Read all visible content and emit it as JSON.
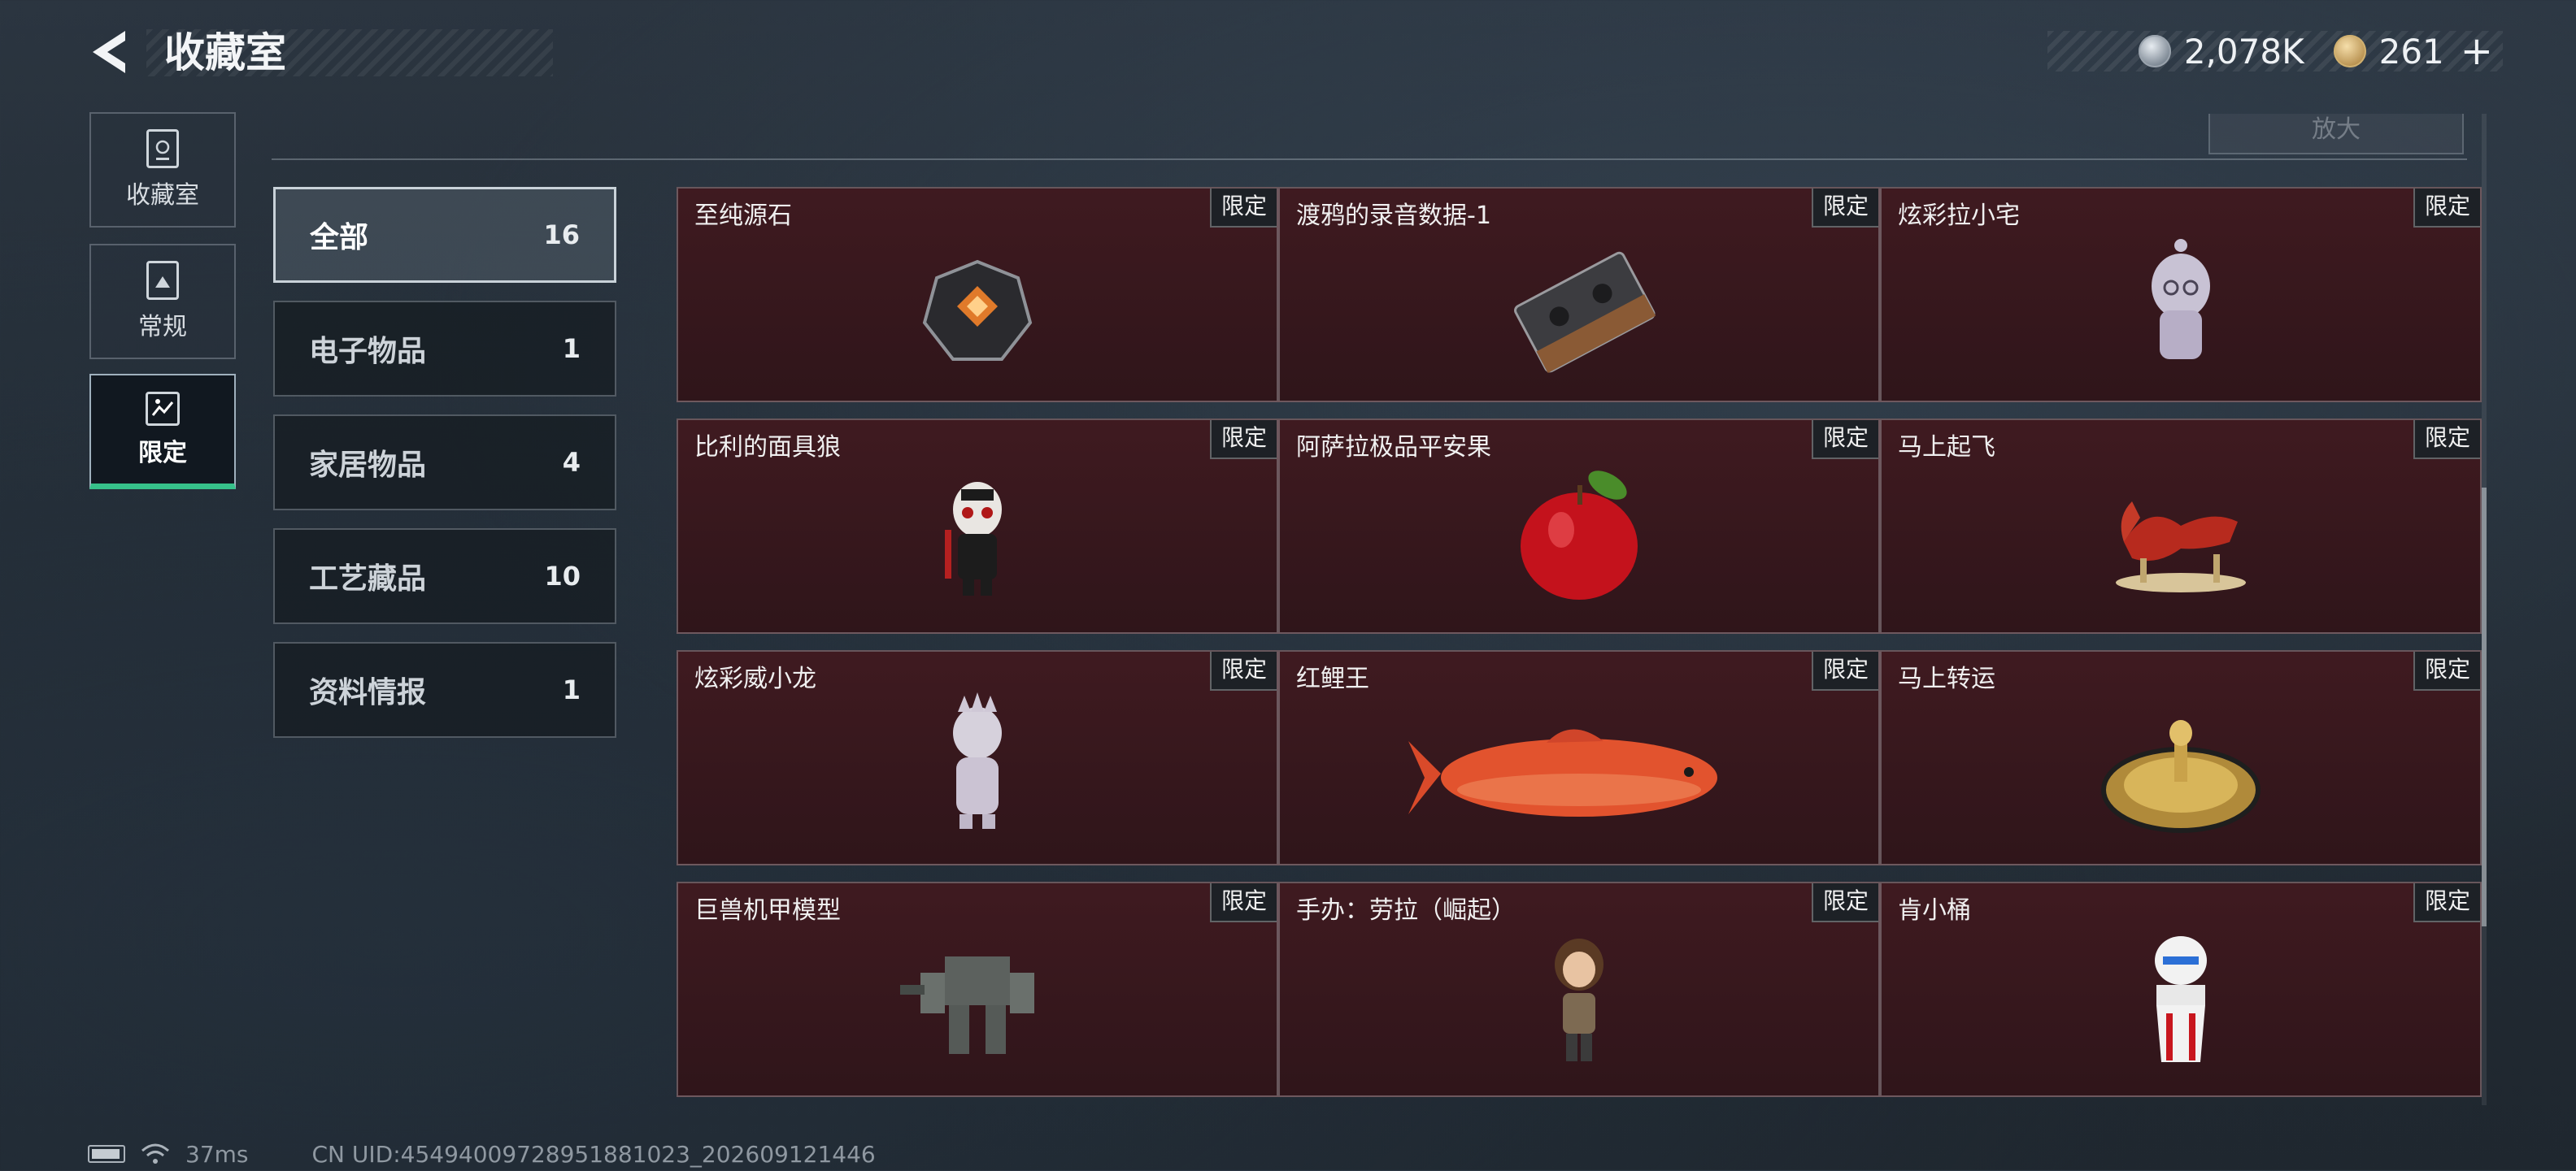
{
  "header": {
    "title": "收藏室",
    "currency": [
      {
        "icon": "silver-coin-icon",
        "value": "2,078K"
      },
      {
        "icon": "gold-coin-icon",
        "value": "261"
      }
    ],
    "plus": "+"
  },
  "left_nav": [
    {
      "label": "收藏室",
      "icon": "vault-icon",
      "active": false
    },
    {
      "label": "常规",
      "icon": "photo-card-icon",
      "active": false
    },
    {
      "label": "限定",
      "icon": "limited-icon",
      "active": true
    }
  ],
  "top_button": "放大",
  "categories": [
    {
      "label": "全部",
      "count": "16",
      "active": true
    },
    {
      "label": "电子物品",
      "count": "1",
      "active": false
    },
    {
      "label": "家居物品",
      "count": "4",
      "active": false
    },
    {
      "label": "工艺藏品",
      "count": "10",
      "active": false
    },
    {
      "label": "资料情报",
      "count": "1",
      "active": false
    }
  ],
  "items": [
    {
      "name": "至纯源石",
      "badge": "限定"
    },
    {
      "name": "渡鸦的录音数据-1",
      "badge": "限定"
    },
    {
      "name": "炫彩拉小宅",
      "badge": "限定"
    },
    {
      "name": "比利的面具狼",
      "badge": "限定"
    },
    {
      "name": "阿萨拉极品平安果",
      "badge": "限定"
    },
    {
      "name": "马上起飞",
      "badge": "限定"
    },
    {
      "name": "炫彩威小龙",
      "badge": "限定"
    },
    {
      "name": "红鲤王",
      "badge": "限定"
    },
    {
      "name": "马上转运",
      "badge": "限定"
    },
    {
      "name": "巨兽机甲模型",
      "badge": "限定"
    },
    {
      "name": "手办：劳拉（崛起）",
      "badge": "限定"
    },
    {
      "name": "肯小桶",
      "badge": "限定"
    }
  ],
  "status_bar": {
    "ping": "37ms",
    "uid": "CN UID:45494009728951881023_202609121446"
  }
}
